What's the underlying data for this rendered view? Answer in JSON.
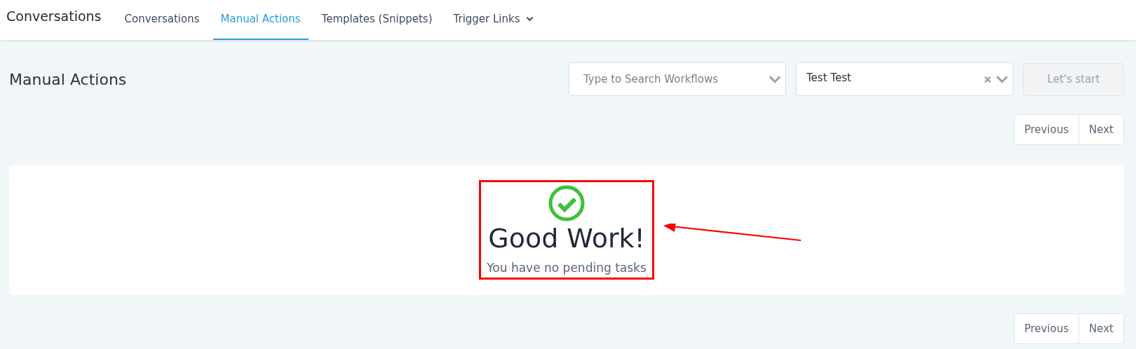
{
  "app_title": "Conversations",
  "tabs": [
    {
      "label": "Conversations",
      "selected": false,
      "has_menu": false
    },
    {
      "label": "Manual Actions",
      "selected": true,
      "has_menu": false
    },
    {
      "label": "Templates (Snippets)",
      "selected": false,
      "has_menu": false
    },
    {
      "label": "Trigger Links",
      "selected": false,
      "has_menu": true
    }
  ],
  "page_title": "Manual Actions",
  "workflow_select": {
    "placeholder": "Type to Search Workflows"
  },
  "user_select": {
    "value": "Test Test",
    "clearable": true
  },
  "start_button": {
    "label": "Let's start",
    "disabled": true
  },
  "pagination_top": {
    "previous": "Previous",
    "next": "Next"
  },
  "empty_state": {
    "title": "Good Work!",
    "message": "You have no pending tasks",
    "highlighted": true,
    "arrow": true
  },
  "pagination_bottom": {
    "previous": "Previous",
    "next": "Next"
  }
}
